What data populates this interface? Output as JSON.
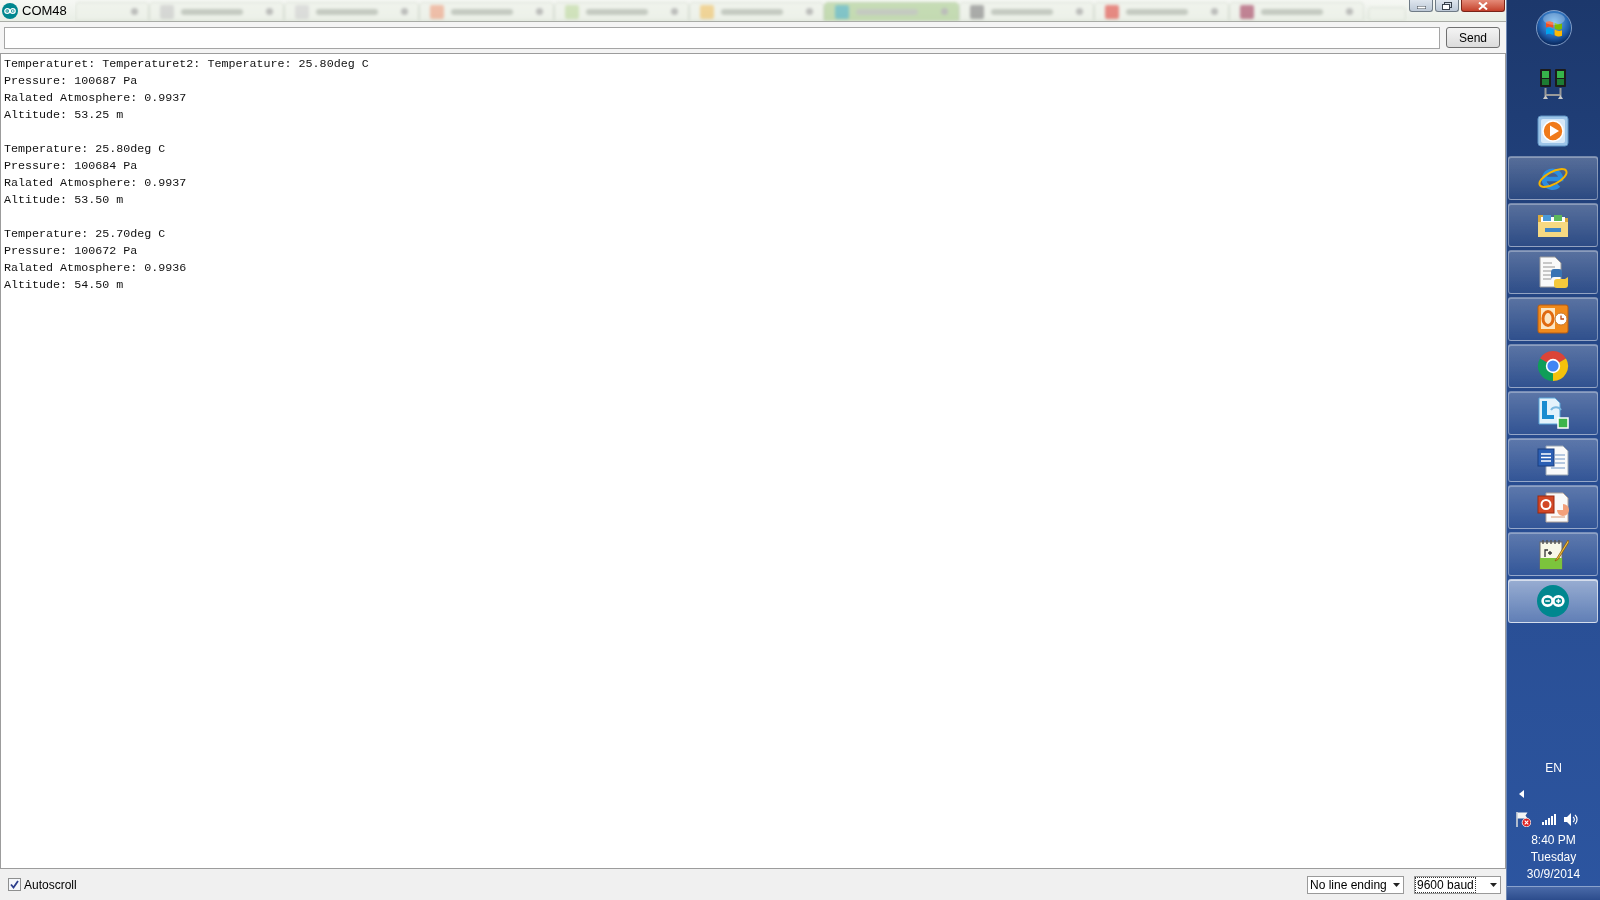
{
  "window": {
    "title": "COM48"
  },
  "send_bar": {
    "button": "Send"
  },
  "output": {
    "blocks": [
      {
        "lines": [
          "Temperaturet: Temperaturet2: Temperature: 25.80deg C",
          "Pressure: 100687 Pa",
          "Ralated Atmosphere: 0.9937",
          "Altitude: 53.25 m"
        ]
      },
      {
        "lines": [
          "Temperature: 25.80deg C",
          "Pressure: 100684 Pa",
          "Ralated Atmosphere: 0.9937",
          "Altitude: 53.50 m"
        ]
      },
      {
        "lines": [
          "Temperature: 25.70deg C",
          "Pressure: 100672 Pa",
          "Ralated Atmosphere: 0.9936",
          "Altitude: 54.50 m"
        ]
      }
    ]
  },
  "footer": {
    "autoscroll": {
      "label": "Autoscroll",
      "checked": true
    },
    "dropdowns": [
      {
        "value": "No line ending",
        "focused": false
      },
      {
        "value": "9600 baud",
        "focused": true
      }
    ]
  },
  "taskbar": {
    "buttons": [
      {
        "running": false,
        "selected": false
      },
      {
        "running": false,
        "selected": false
      },
      {
        "running": true,
        "selected": false
      },
      {
        "running": true,
        "selected": false
      },
      {
        "running": true,
        "selected": false
      },
      {
        "running": true,
        "selected": false
      },
      {
        "running": true,
        "selected": false
      },
      {
        "running": true,
        "selected": false
      },
      {
        "running": true,
        "selected": false
      },
      {
        "running": true,
        "selected": false
      },
      {
        "running": true,
        "selected": false
      },
      {
        "running": true,
        "selected": true
      }
    ]
  },
  "tray": {
    "language": "EN",
    "time": "8:40 PM",
    "day": "Tuesday",
    "date": "30/9/2014"
  }
}
